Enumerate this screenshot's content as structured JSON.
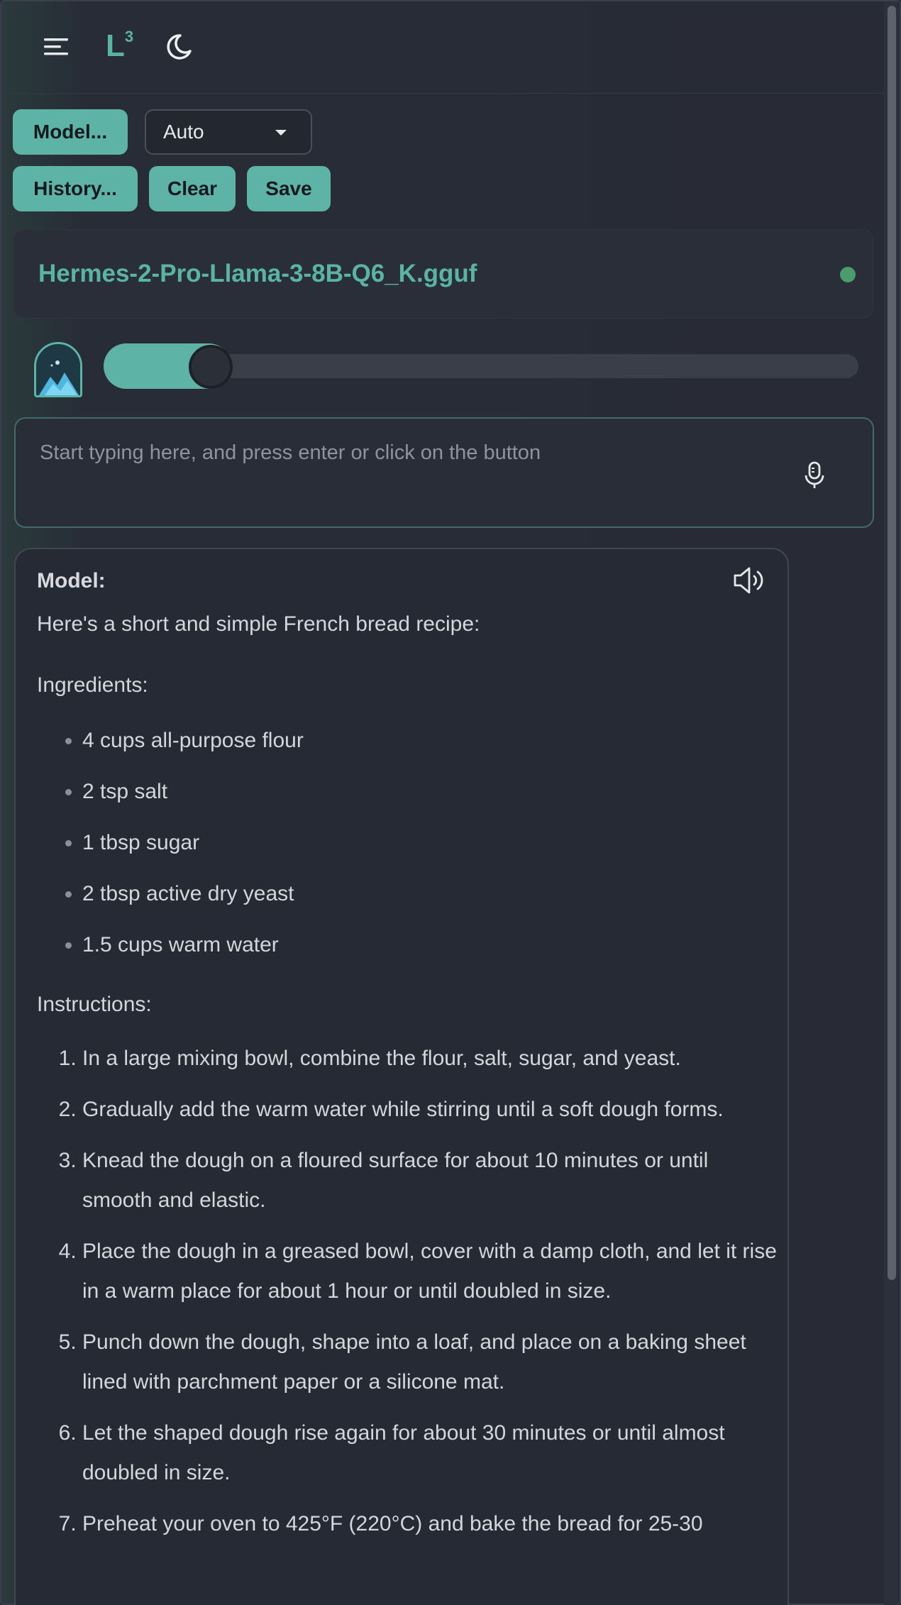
{
  "header": {
    "logo_text": "L",
    "logo_sup": "3",
    "menu_icon": "hamburger-menu-icon",
    "theme_icon": "moon-icon"
  },
  "toolbar": {
    "model_label": "Model...",
    "model_select_value": "Auto",
    "history_label": "History...",
    "clear_label": "Clear",
    "save_label": "Save"
  },
  "model_card": {
    "name": "Hermes-2-Pro-Llama-3-8B-Q6_K.gguf",
    "status_color": "#4a9c6a"
  },
  "slider": {
    "value_fraction": 0.1
  },
  "input": {
    "placeholder": "Start typing here, and press enter or click on the button",
    "mic_icon": "microphone-icon"
  },
  "message": {
    "author": "Model:",
    "speaker_icon": "speaker-icon",
    "intro": "Here's a short and simple French bread recipe:",
    "ingredients_heading": "Ingredients:",
    "ingredients": [
      "4 cups all-purpose flour",
      "2 tsp salt",
      "1 tbsp sugar",
      "2 tbsp active dry yeast",
      "1.5 cups warm water"
    ],
    "instructions_heading": "Instructions:",
    "instructions": [
      "In a large mixing bowl, combine the flour, salt, sugar, and yeast.",
      "Gradually add the warm water while stirring until a soft dough forms.",
      "Knead the dough on a floured surface for about 10 minutes or until smooth and elastic.",
      "Place the dough in a greased bowl, cover with a damp cloth, and let it rise in a warm place for about 1 hour or until doubled in size.",
      "Punch down the dough, shape into a loaf, and place on a baking sheet lined with parchment paper or a silicone mat.",
      "Let the shaped dough rise again for about 30 minutes or until almost doubled in size.",
      "Preheat your oven to 425°F (220°C) and bake the bread for 25-30"
    ]
  },
  "colors": {
    "accent": "#5eb3a7",
    "background": "#262a35"
  }
}
